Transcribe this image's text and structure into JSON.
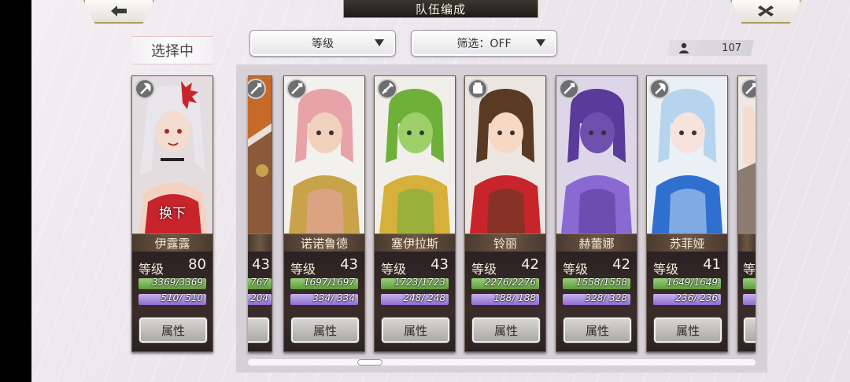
{
  "header": {
    "title": "队伍编成",
    "back_icon": "arrow-left-icon",
    "close_icon": "close-icon"
  },
  "current_tag": "选择中",
  "sort_dropdown": {
    "value": "等级"
  },
  "filter_dropdown": {
    "value": "筛选：OFF"
  },
  "member_count": "107",
  "level_label": "等级",
  "attr_label": "属性",
  "current_card": {
    "name": "伊露露",
    "level": "80",
    "hp": "3369/3369",
    "mp": "510/ 510",
    "overlay": "换下",
    "weapon_icon": "axe-icon",
    "hp_ratio": 1.0,
    "mp_ratio": 1.0,
    "colors": {
      "hair": "#e8e6ea",
      "accent": "#c8242c",
      "skin": "#f5dcd0",
      "bg": "#e4dde0"
    }
  },
  "partial_card": {
    "level": "43",
    "hp": "767",
    "mp": "204",
    "weapon_icon": "spear-icon"
  },
  "cards": [
    {
      "name": "诺诺鲁德",
      "level": "43",
      "hp": "1697/1697",
      "mp": "334/ 334",
      "weapon_icon": "spear-icon",
      "hp_ratio": 1.0,
      "mp_ratio": 1.0,
      "colors": {
        "hair": "#e8a3a8",
        "accent": "#c9a34a",
        "skin": "#f1d0bc",
        "bg": "#f3f1ee"
      }
    },
    {
      "name": "塞伊拉斯",
      "level": "43",
      "hp": "1723/1723",
      "mp": "248/ 248",
      "weapon_icon": "sword-icon",
      "hp_ratio": 1.0,
      "mp_ratio": 1.0,
      "colors": {
        "hair": "#6fb03a",
        "accent": "#d6b03a",
        "skin": "#9ed06a",
        "bg": "#f0efe9"
      }
    },
    {
      "name": "铃丽",
      "level": "42",
      "hp": "2276/2276",
      "mp": "188/ 188",
      "weapon_icon": "gauntlet-icon",
      "hp_ratio": 1.0,
      "mp_ratio": 1.0,
      "colors": {
        "hair": "#5b3a24",
        "accent": "#c8242c",
        "skin": "#f6d8c3",
        "bg": "#ece6e2"
      }
    },
    {
      "name": "赫蕾娜",
      "level": "42",
      "hp": "1558/1558",
      "mp": "328/ 328",
      "weapon_icon": "spear-icon",
      "hp_ratio": 1.0,
      "mp_ratio": 1.0,
      "colors": {
        "hair": "#5a3a9a",
        "accent": "#8a6ad2",
        "skin": "#6e4fae",
        "bg": "#dcd6e8"
      }
    },
    {
      "name": "苏菲娅",
      "level": "41",
      "hp": "1649/1649",
      "mp": "236/ 236",
      "weapon_icon": "axe-icon",
      "hp_ratio": 1.0,
      "mp_ratio": 1.0,
      "colors": {
        "hair": "#b7d4ee",
        "accent": "#2f6fd0",
        "skin": "#f6e3dc",
        "bg": "#eaf0f6"
      }
    }
  ],
  "trailing_card": {
    "level_label": "等",
    "weapon_icon": "spear-icon"
  }
}
